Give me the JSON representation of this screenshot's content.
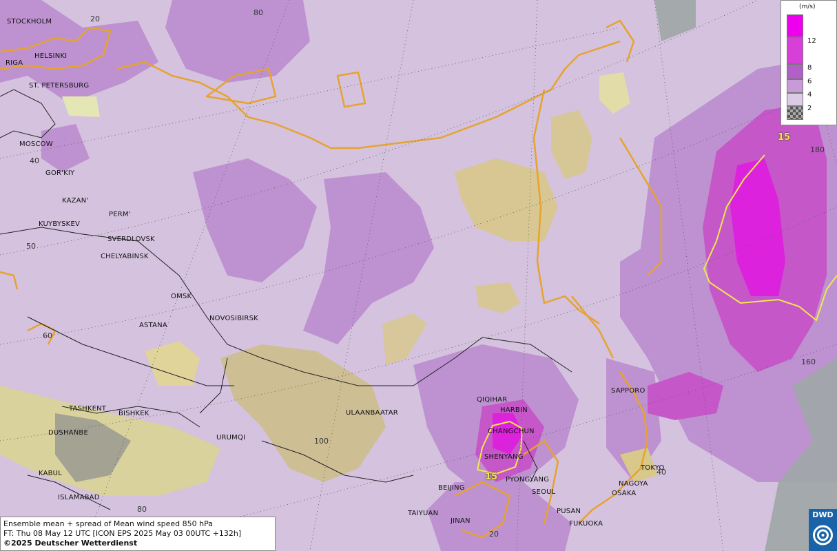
{
  "legend": {
    "unit": "(m/s)",
    "items": [
      {
        "label": "12",
        "color": "#ee00ee"
      },
      {
        "label": "8",
        "color": "#d640d6"
      },
      {
        "label": "6",
        "color": "#b060c6"
      },
      {
        "label": "4",
        "color": "#c79ad8"
      },
      {
        "label": "2",
        "color": "#dccbe6"
      },
      {
        "label": "",
        "color": "checker"
      }
    ]
  },
  "info": {
    "line1": "Ensemble mean + spread of Mean wind speed 850 hPa",
    "line2": "FT: Thu 08 May 12 UTC [ICON EPS 2025 May 03 00UTC +132h]",
    "line3": "©2025 Deutscher Wetterdienst"
  },
  "logo": {
    "text": "DWD"
  },
  "cities": {
    "stockholm": "STOCKHOLM",
    "helsinki": "HELSINKI",
    "riga": "RIGA",
    "st_petersburg": "ST. PETERSBURG",
    "moscow": "MOSCOW",
    "gorkiy": "GOR'KIY",
    "kazan": "KAZAN'",
    "perm": "PERM'",
    "kuybyshev": "KUYBYSKEV",
    "sverdlovsk": "SVERDLOVSK",
    "chelyabinsk": "CHELYABINSK",
    "omsk": "OMSK",
    "astana": "ASTANA",
    "novosibirsk": "NOVOSIBIRSK",
    "tashkent": "TASHKENT",
    "bishkek": "BISHKEK",
    "dushanbe": "DUSHANBE",
    "urumqi": "URUMQI",
    "kabul": "KABUL",
    "islamabad": "ISLAMABAD",
    "ulaanbaatar": "ULAANBAATAR",
    "qiqihar": "QIQIHAR",
    "harbin": "HARBIN",
    "changchun": "CHANGCHUN",
    "shenyang": "SHENYANG",
    "beijing": "BEIJING",
    "pyongyang": "PYONGYANG",
    "seoul": "SEOUL",
    "taiyuan": "TAIYUAN",
    "jinan": "JINAN",
    "pusan": "PUSAN",
    "fukuoka": "FUKUOKA",
    "sapporo": "SAPPORO",
    "tokyo": "TOKYO",
    "nagoya": "NAGOYA",
    "osaka": "OSAKA"
  },
  "grid_labels": {
    "lon20": "20",
    "lat80": "80",
    "lat40": "40",
    "lat50": "50",
    "lat60": "60",
    "lon100": "100",
    "lon80": "80",
    "lon120": "20",
    "lon140": "40",
    "lon160": "160",
    "lon180": "180"
  },
  "isolines": {
    "label_ne": "15",
    "label_china": "15"
  }
}
